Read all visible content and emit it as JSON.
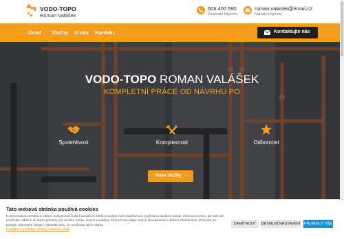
{
  "header": {
    "brand_name": "VODO-TOPO",
    "brand_sub": "Roman Valášek",
    "phone": "606 400 590",
    "phone_sub": "Zavolejte kdykoliv",
    "email": "roman.valasek@email.cz",
    "email_sub": "Napište kdykoliv"
  },
  "nav": {
    "items": [
      {
        "label": "Úvod"
      },
      {
        "label": "Služby"
      },
      {
        "label": "O nás"
      },
      {
        "label": "Kontakt"
      }
    ],
    "cta_label": "Kontaktujte nás"
  },
  "hero": {
    "title_bold": "VODO-TOPO",
    "title_rest": " ROMAN VALÁŠEK",
    "subtitle": "KOMPLETNÍ PRÁCE OD NÁVRHU PO",
    "features": [
      {
        "label": "Spolehlivost",
        "icon": "handshake-icon"
      },
      {
        "label": "Komplexnost",
        "icon": "tools-icon"
      },
      {
        "label": "Odbornost",
        "icon": "star-icon"
      }
    ],
    "button_label": "Naše služby",
    "button_chevron": "⌄"
  },
  "cookie": {
    "title": "Tato webová stránka používá cookies",
    "text": "K personalizaci obsahu a reklam, poskytování funkcí sociálních médií a analýze naší návštěvnosti využíváme soubory cookie. Informace o tom, jak náš web používáte, sdílíme se svými partnery pro sociální média, inzerci a analýzy. Partneři tyto údaje mohou zkombinovat s dalšími informacemi, které jste jim poskytli nebo které získali v důsledku toho, že používáte jejich služby.",
    "link": "Prohlášení o Zásady ochrany osobních údajů",
    "reject_label": "ZAMÍTNOUT",
    "settings_label": "DETAILNÍ NASTAVENÍ",
    "accept_label": "PŘIJMOUT VŠE"
  },
  "colors": {
    "accent": "#f59d1d",
    "dark": "#1f1f1f",
    "accept_blue": "#1e8fd2"
  }
}
